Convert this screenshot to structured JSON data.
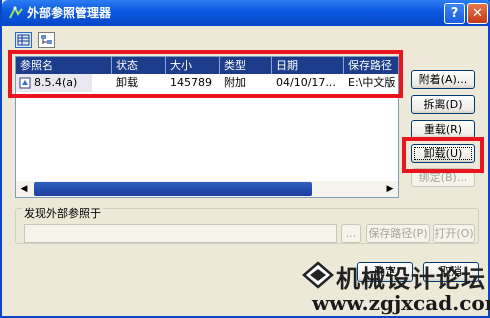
{
  "window": {
    "title": "外部参照管理器",
    "help_label": "?",
    "close_label": "✕"
  },
  "toolbar": {
    "list_view_icon": "list-view-icon",
    "tree_view_icon": "tree-view-icon"
  },
  "table": {
    "columns": [
      "参照名",
      "状态",
      "大小",
      "类型",
      "日期",
      "保存路径"
    ],
    "rows": [
      {
        "name": "8.5.4(a)",
        "status": "卸载",
        "size": "145789",
        "type": "附加",
        "date": "04/10/17...",
        "path": "E:\\中文版"
      }
    ]
  },
  "buttons": {
    "attach": "附着(A)...",
    "detach": "拆离(D)",
    "reload": "重载(R)",
    "unload": "卸载(U)",
    "bind": "绑定(B)..."
  },
  "found_at": {
    "label": "发现外部参照于",
    "value": "",
    "browse": "...",
    "save_path": "保存路径(P)",
    "open": "打开(O)"
  },
  "footer": {
    "ok": "确定",
    "cancel": "取消"
  },
  "watermark": {
    "cn": "机械设计论坛",
    "url": "www.zgjxcad.com"
  },
  "colors": {
    "highlight_border": "#e8141e",
    "title_bar": "#0a58e0",
    "header_row": "#1e3c8c"
  }
}
